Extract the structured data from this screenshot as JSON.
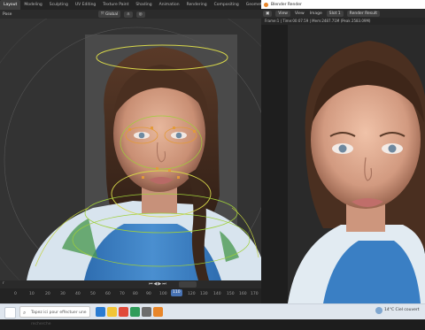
{
  "blender": {
    "workspace_tabs": [
      "Layout",
      "Modeling",
      "Sculpting",
      "UV Editing",
      "Texture Paint",
      "Shading",
      "Animation",
      "Rendering",
      "Compositing",
      "Geometry Nodes",
      "Scripting"
    ],
    "active_tab": "Layout",
    "mode_label": "Pose",
    "orientation_label": "Global",
    "timeline": {
      "ticks": [
        "0",
        "10",
        "20",
        "30",
        "40",
        "50",
        "60",
        "70",
        "80",
        "90",
        "100",
        "110",
        "120",
        "130",
        "140",
        "150",
        "160",
        "170"
      ],
      "current_frame": "110",
      "left_label": "r"
    }
  },
  "render_window": {
    "title": "Blender Render",
    "menu": {
      "view": "View",
      "view2": "View",
      "image": "Image",
      "slot": "Slot 1",
      "layer": "Render Result"
    },
    "status": "Frame:1 | Time:00:07.59 | Mem:2487.71M (Peak 2583.09M)"
  },
  "taskbar": {
    "search_placeholder": "Tapez ici pour effectuer une recherche",
    "weather": "14°C  Ciel couvert"
  },
  "icons": {
    "start": "windows-start-icon",
    "search": "search-icon"
  },
  "colors": {
    "accent": "#4772b3",
    "rig_yellow": "#d6d64a",
    "rig_green": "#9fcf3a",
    "rig_orange": "#e39a3a"
  }
}
